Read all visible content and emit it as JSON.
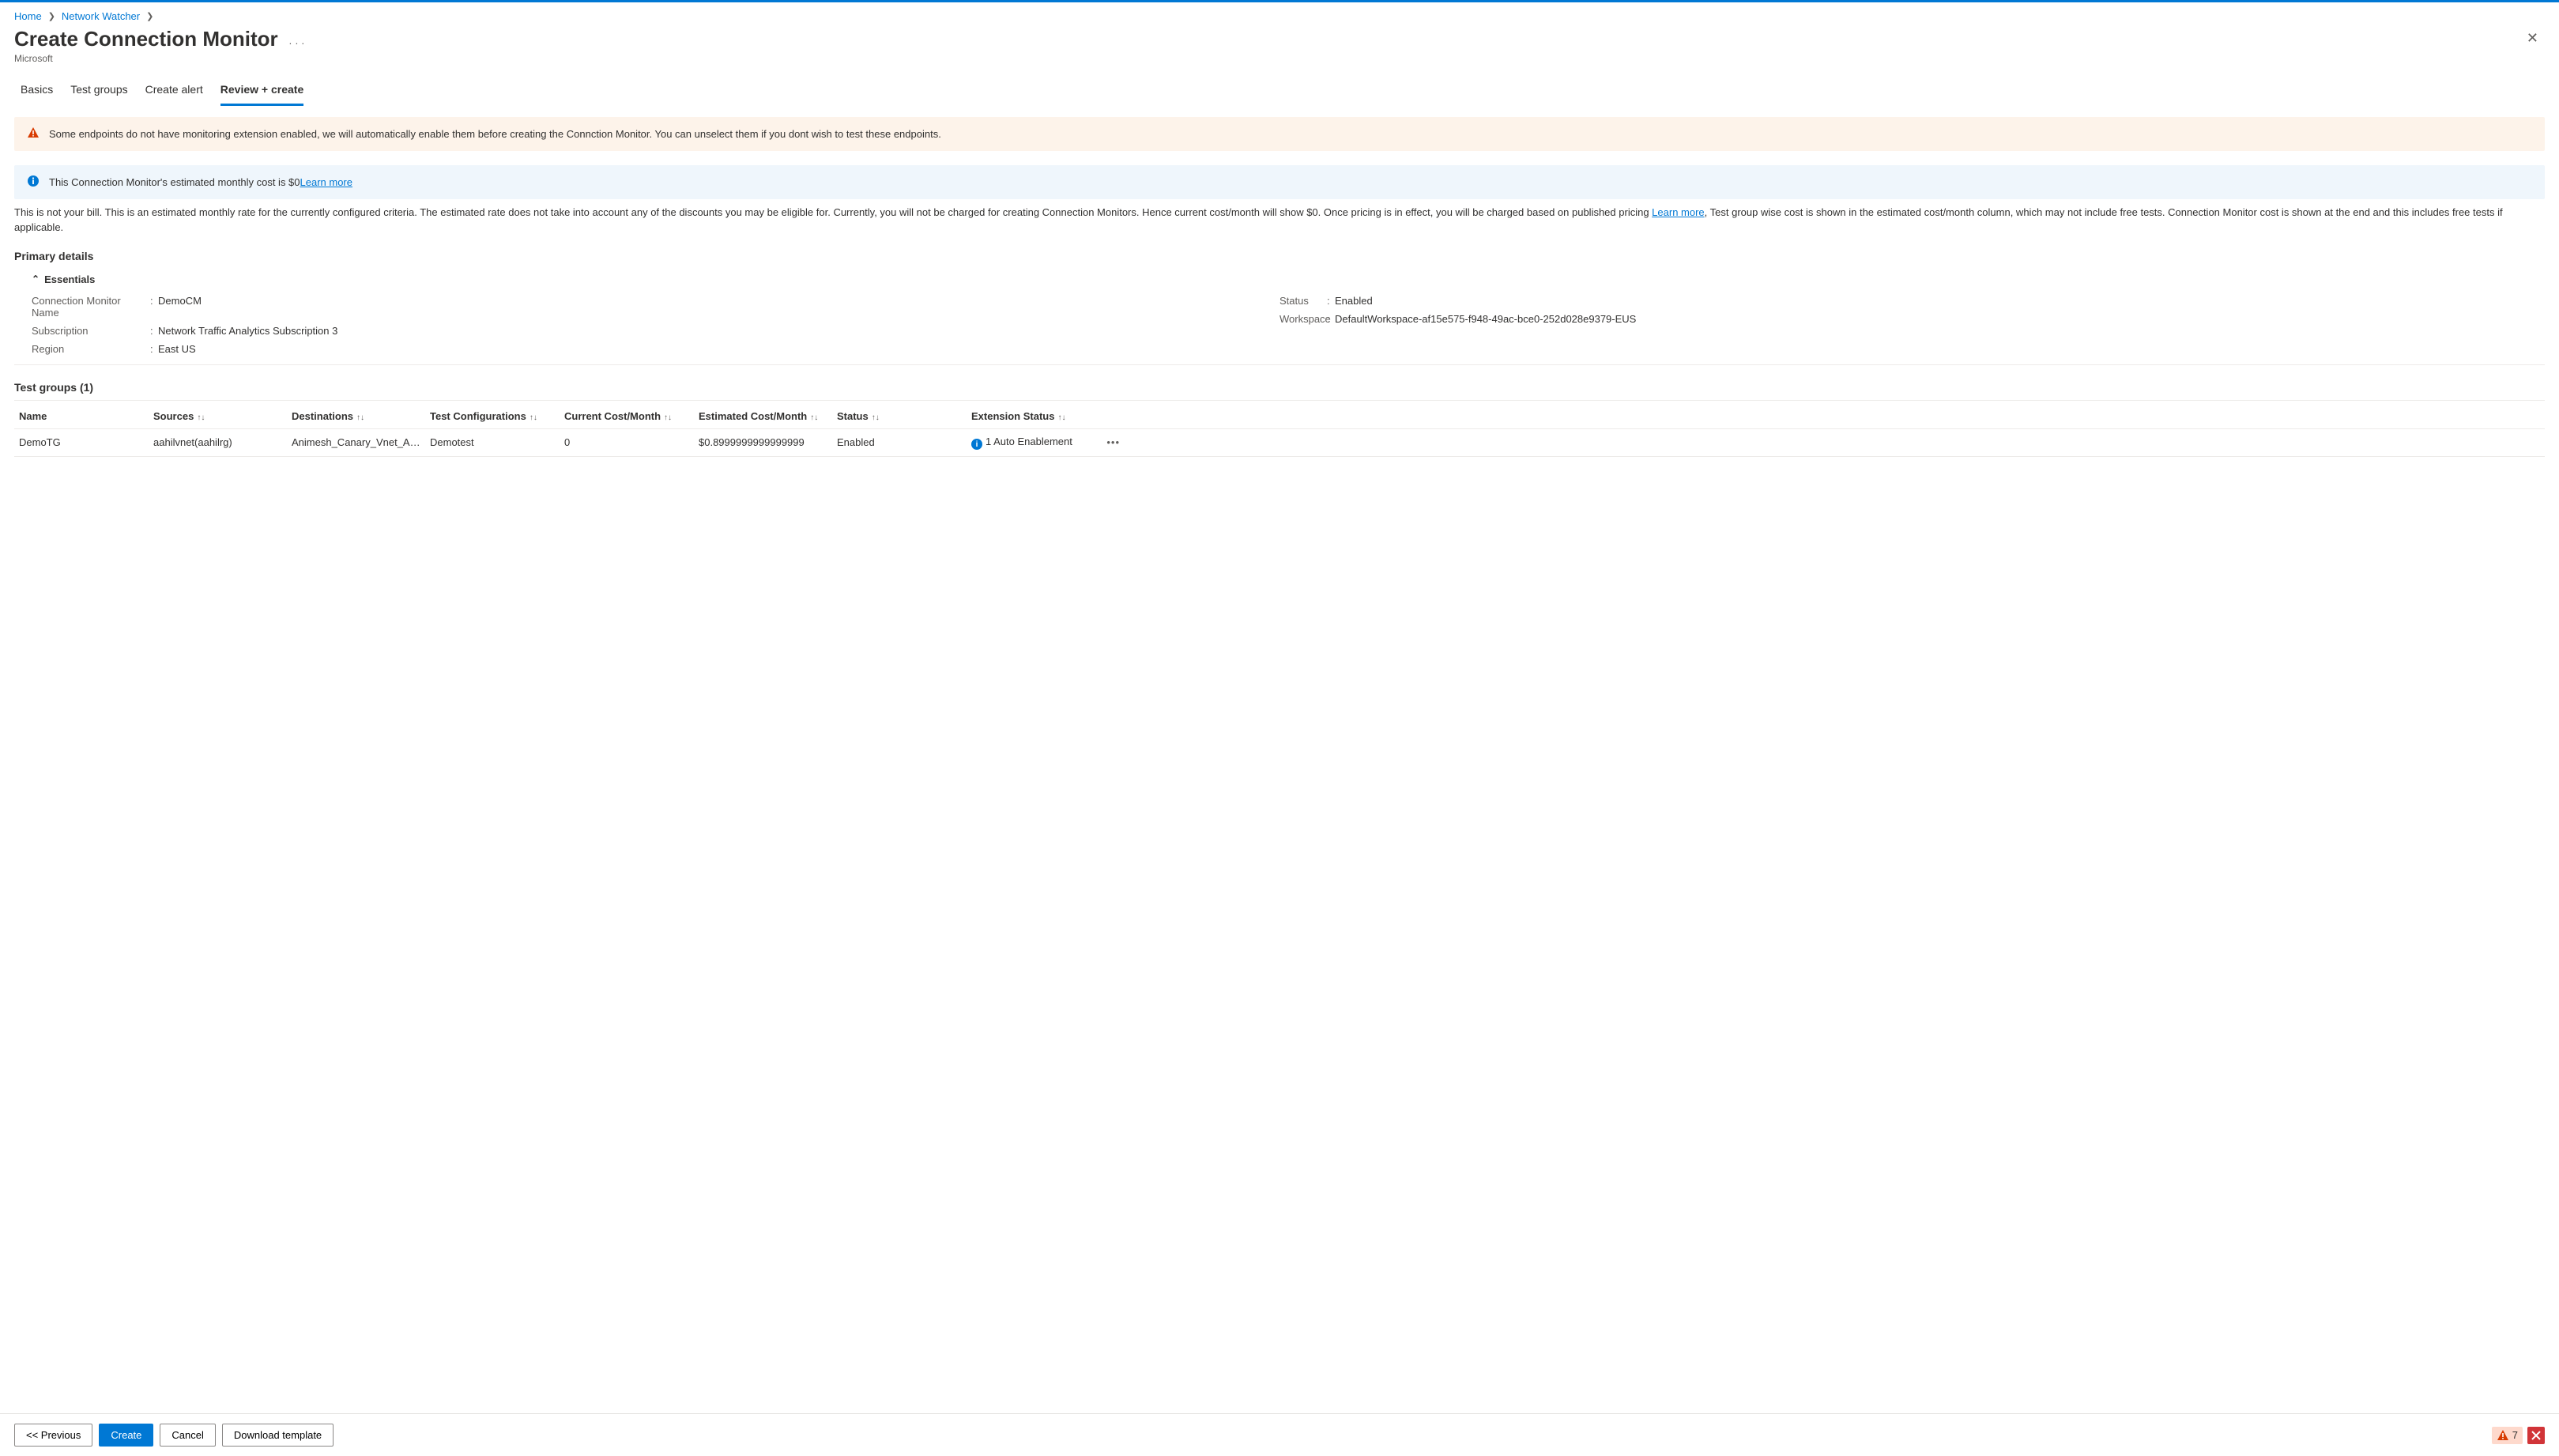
{
  "breadcrumb": {
    "home": "Home",
    "nw": "Network Watcher"
  },
  "header": {
    "title": "Create Connection Monitor",
    "subtitle": "Microsoft"
  },
  "tabs": {
    "basics": "Basics",
    "testgroups": "Test groups",
    "alert": "Create alert",
    "review": "Review + create"
  },
  "banners": {
    "warn": "Some endpoints do not have monitoring extension enabled, we will automatically enable them before creating the Connction Monitor. You can unselect them if you dont wish to test these endpoints.",
    "info_pre": "This Connection Monitor's estimated monthly cost is $0",
    "info_link": "Learn more"
  },
  "note": {
    "p1": "This is not your bill. This is an estimated monthly rate for the currently configured criteria. The estimated rate does not take into account any of the discounts you may be eligible for. Currently, you will not be charged for creating Connection Monitors. Hence current cost/month will show $0. Once pricing is in effect, you will be charged based on published pricing ",
    "link": "Learn more",
    "p2": ", Test group wise cost is shown in the estimated cost/month column, which may not include free tests. Connection Monitor cost is shown at the end and this includes free tests if applicable."
  },
  "primary": {
    "heading": "Primary details",
    "essentials": "Essentials",
    "left": {
      "k1": "Connection Monitor Name",
      "v1": "DemoCM",
      "k2": "Subscription",
      "v2": "Network Traffic Analytics Subscription 3",
      "k3": "Region",
      "v3": "East US"
    },
    "right": {
      "k1": "Status",
      "v1": "Enabled",
      "k2": "Workspace",
      "v2": "DefaultWorkspace-af15e575-f948-49ac-bce0-252d028e9379-EUS"
    }
  },
  "grid": {
    "title": "Test groups (1)",
    "cols": {
      "name": "Name",
      "src": "Sources",
      "dst": "Destinations",
      "tc": "Test Configurations",
      "cc": "Current Cost/Month",
      "ec": "Estimated Cost/Month",
      "st": "Status",
      "ext": "Extension Status"
    },
    "row": {
      "name": "DemoTG",
      "src": "aahilvnet(aahilrg)",
      "dst": "Animesh_Canary_Vnet_ANM(...",
      "tc": "Demotest",
      "cc": "0",
      "ec": "$0.8999999999999999",
      "st": "Enabled",
      "ext": "1 Auto Enablement"
    }
  },
  "footer": {
    "prev": "<< Previous",
    "create": "Create",
    "cancel": "Cancel",
    "download": "Download template",
    "warn_count": "7"
  }
}
